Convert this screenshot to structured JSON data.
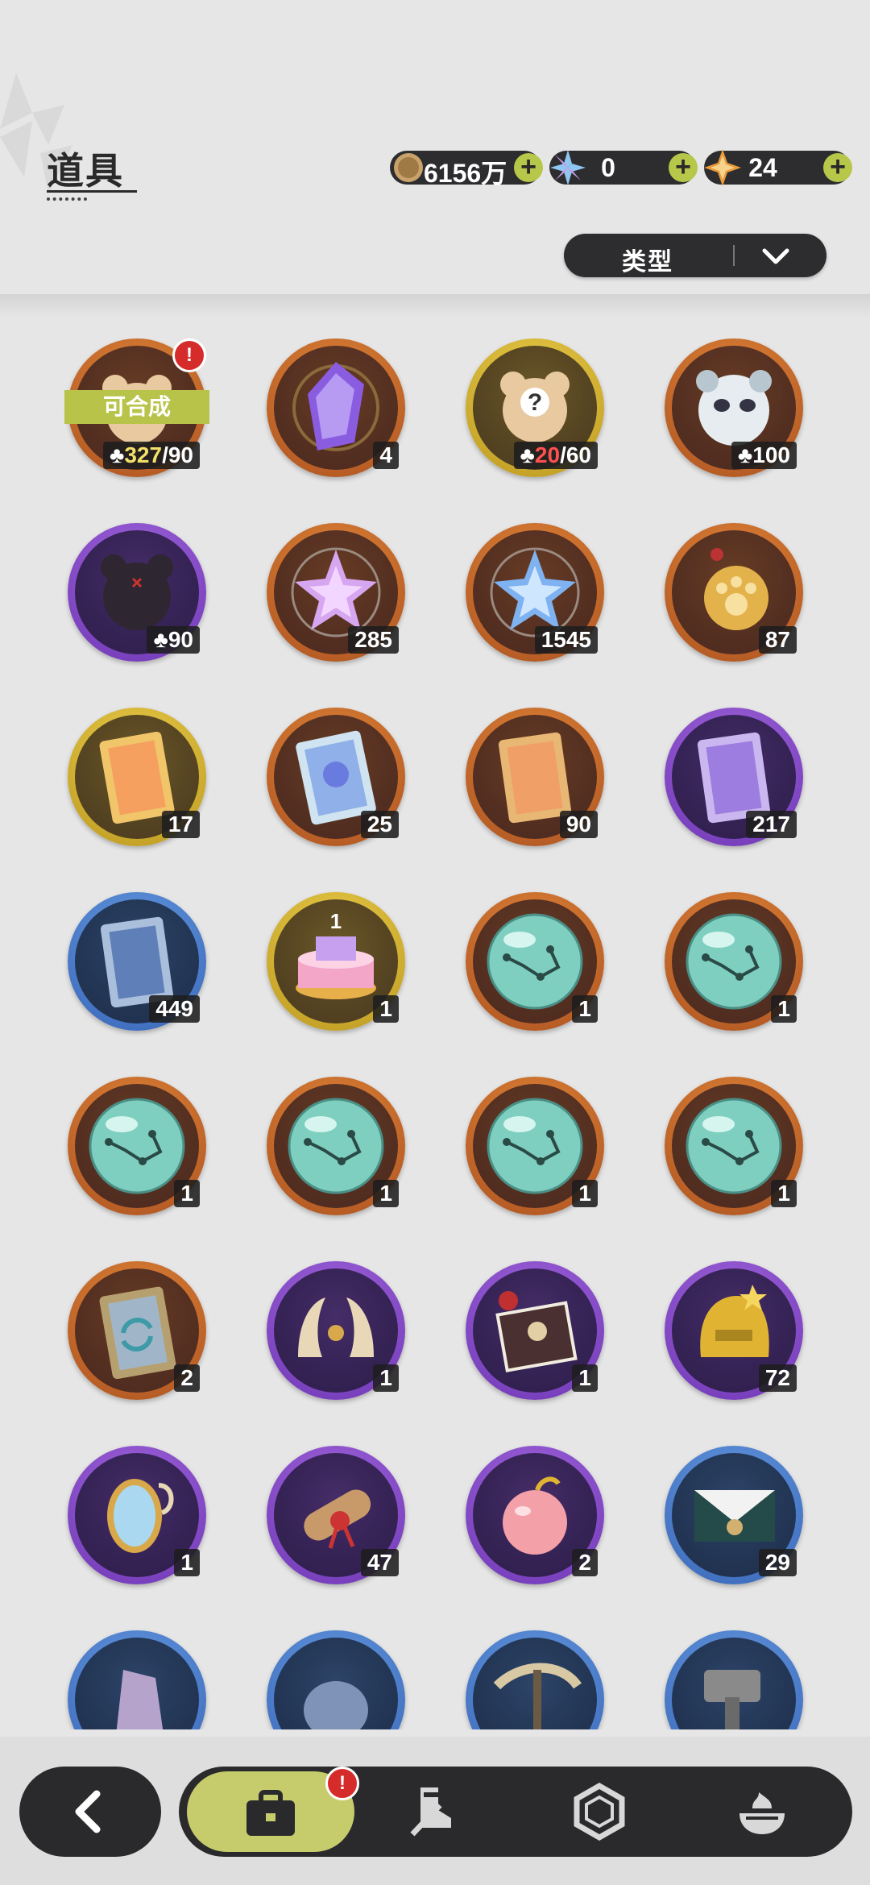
{
  "header": {
    "title": "道具"
  },
  "currencies": [
    {
      "icon": "gold-coin-icon",
      "value": "6156万"
    },
    {
      "icon": "crystal-flower-icon",
      "value": "0"
    },
    {
      "icon": "star-gem-icon",
      "value": "24"
    }
  ],
  "filter": {
    "label": "类型"
  },
  "items": [
    {
      "name": "bear-fragment",
      "icon": "bear-silhouette-icon",
      "ring": "orange",
      "count": "327/90",
      "count_have": "327",
      "count_need": "/90",
      "fragment": true,
      "synth": "可合成",
      "badge": "!"
    },
    {
      "name": "purple-crystal-card",
      "icon": "purple-crystal-icon",
      "ring": "orange",
      "count": "4"
    },
    {
      "name": "mystery-fragment",
      "icon": "mystery-question-icon",
      "ring": "yellow",
      "count": "20/60",
      "count_have": "20",
      "count_need": "/60",
      "fragment": true
    },
    {
      "name": "panda-fragment",
      "icon": "panda-creature-icon",
      "ring": "orange",
      "count": "100",
      "fragment": true
    },
    {
      "name": "dark-bear-fragment",
      "icon": "dark-bear-icon",
      "ring": "purple",
      "count": "90",
      "fragment": true
    },
    {
      "name": "pink-star-crystal",
      "icon": "pink-star-crystal-icon",
      "ring": "orange",
      "count": "285"
    },
    {
      "name": "blue-star-crystal",
      "icon": "blue-star-crystal-icon",
      "ring": "orange",
      "count": "1545"
    },
    {
      "name": "paw-medal",
      "icon": "paw-medal-icon",
      "ring": "orange",
      "count": "87"
    },
    {
      "name": "gold-card",
      "icon": "gold-character-card-icon",
      "ring": "yellow",
      "count": "17"
    },
    {
      "name": "holo-card",
      "icon": "holo-character-card-icon",
      "ring": "orange",
      "count": "25"
    },
    {
      "name": "orange-card",
      "icon": "orange-character-card-icon",
      "ring": "orange",
      "count": "90"
    },
    {
      "name": "purple-card",
      "icon": "purple-character-card-icon",
      "ring": "purple",
      "count": "217"
    },
    {
      "name": "blue-card",
      "icon": "blue-character-card-icon",
      "ring": "blue",
      "count": "449"
    },
    {
      "name": "birthday-cake",
      "icon": "birthday-cake-icon",
      "ring": "yellow",
      "count": "1"
    },
    {
      "name": "orb-1",
      "icon": "constellation-orb-icon",
      "ring": "orange",
      "count": "1"
    },
    {
      "name": "orb-2",
      "icon": "constellation-orb-icon",
      "ring": "orange",
      "count": "1"
    },
    {
      "name": "orb-3",
      "icon": "constellation-orb-icon",
      "ring": "orange",
      "count": "1"
    },
    {
      "name": "orb-4",
      "icon": "constellation-orb-icon",
      "ring": "orange",
      "count": "1"
    },
    {
      "name": "orb-5",
      "icon": "constellation-orb-icon",
      "ring": "orange",
      "count": "1"
    },
    {
      "name": "orb-6",
      "icon": "constellation-orb-icon",
      "ring": "orange",
      "count": "1"
    },
    {
      "name": "reset-card",
      "icon": "reset-card-icon",
      "ring": "orange",
      "count": "2"
    },
    {
      "name": "golden-horns",
      "icon": "golden-horns-icon",
      "ring": "purple",
      "count": "1"
    },
    {
      "name": "gift-box",
      "icon": "gift-box-icon",
      "ring": "purple",
      "count": "1"
    },
    {
      "name": "gold-helmet",
      "icon": "gold-helmet-icon",
      "ring": "purple",
      "count": "72"
    },
    {
      "name": "magic-mirror",
      "icon": "magic-mirror-icon",
      "ring": "purple",
      "count": "1"
    },
    {
      "name": "scroll",
      "icon": "scroll-icon",
      "ring": "purple",
      "count": "47"
    },
    {
      "name": "pink-apple",
      "icon": "pink-apple-icon",
      "ring": "purple",
      "count": "2"
    },
    {
      "name": "envelope",
      "icon": "envelope-icon",
      "ring": "blue",
      "count": "29"
    },
    {
      "name": "purple-shard",
      "icon": "purple-shard-icon",
      "ring": "blue",
      "count": ""
    },
    {
      "name": "blue-ore",
      "icon": "blue-ore-icon",
      "ring": "blue",
      "count": ""
    },
    {
      "name": "pickaxe",
      "icon": "pickaxe-icon",
      "ring": "blue",
      "count": ""
    },
    {
      "name": "hammer",
      "icon": "hammer-icon",
      "ring": "blue",
      "count": ""
    }
  ],
  "bottom_nav": {
    "back": "back-arrow-icon",
    "tabs": [
      {
        "icon": "briefcase-icon",
        "active": true,
        "badge": "!"
      },
      {
        "icon": "knight-boot-sword-icon",
        "active": false
      },
      {
        "icon": "hexagon-gem-icon",
        "active": false
      },
      {
        "icon": "cauldron-icon",
        "active": false
      }
    ]
  },
  "colors": {
    "ring_orange": "#d8742f",
    "ring_purple": "#8a4fd0",
    "ring_yellow": "#e0c23c",
    "ring_blue": "#4f86d6",
    "accent_green": "#c6cc6c",
    "dark": "#2a2a2c"
  }
}
